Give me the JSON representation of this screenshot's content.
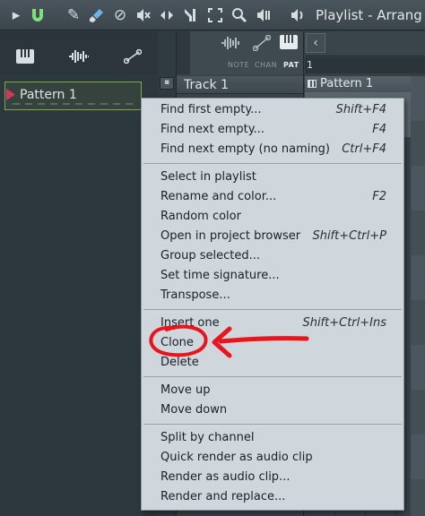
{
  "window": {
    "title": "Playlist - Arrang"
  },
  "toolbar": {
    "icons": [
      "play-arrow-icon",
      "magnet-icon",
      "pencil-icon",
      "paint-brush-icon",
      "delete-circle-icon",
      "mute-icon",
      "slip-icon",
      "slice-icon",
      "select-icon",
      "zoom-icon",
      "playback-icon",
      "speaker-icon"
    ]
  },
  "left_panel": {
    "tab_icons": [
      "piano-icon",
      "waveform-icon",
      "automation-icon"
    ],
    "pattern_item": "Pattern 1"
  },
  "track_header": {
    "label": "Track 1"
  },
  "view_tabs": {
    "tabs": [
      "NOTE",
      "CHAN",
      "PAT"
    ],
    "active": "PAT"
  },
  "ruler": {
    "bar": "1"
  },
  "clip": {
    "label": "Pattern 1"
  },
  "context_menu": {
    "items": [
      {
        "label": "Find first empty...",
        "shortcut": "Shift+F4"
      },
      {
        "label": "Find next empty...",
        "shortcut": "F4"
      },
      {
        "label": "Find next empty (no naming)",
        "shortcut": "Ctrl+F4"
      },
      {
        "label": "Select in playlist",
        "shortcut": ""
      },
      {
        "label": "Rename and color...",
        "shortcut": "F2"
      },
      {
        "label": "Random color",
        "shortcut": ""
      },
      {
        "label": "Open in project browser",
        "shortcut": "Shift+Ctrl+P"
      },
      {
        "label": "Group selected...",
        "shortcut": ""
      },
      {
        "label": "Set time signature...",
        "shortcut": ""
      },
      {
        "label": "Transpose...",
        "shortcut": ""
      },
      {
        "label": "Insert one",
        "shortcut": "Shift+Ctrl+Ins"
      },
      {
        "label": "Clone",
        "shortcut": ""
      },
      {
        "label": "Delete",
        "shortcut": ""
      },
      {
        "label": "Move up",
        "shortcut": ""
      },
      {
        "label": "Move down",
        "shortcut": ""
      },
      {
        "label": "Split by channel",
        "shortcut": ""
      },
      {
        "label": "Quick render as audio clip",
        "shortcut": ""
      },
      {
        "label": "Render as audio clip...",
        "shortcut": ""
      },
      {
        "label": "Render and replace...",
        "shortcut": ""
      }
    ]
  },
  "annotation": {
    "color": "#e8151d",
    "target": "Clone"
  },
  "colors": {
    "pattern_marker": "#d9375a",
    "pattern_border": "#7ca94a",
    "menu_background": "#cfd6dc"
  }
}
